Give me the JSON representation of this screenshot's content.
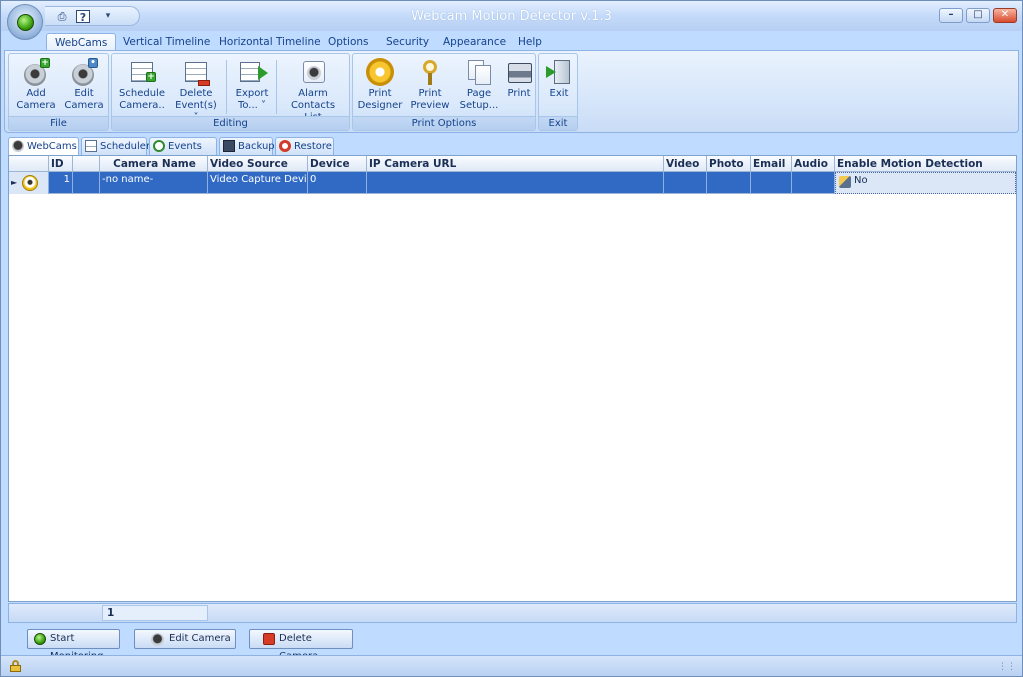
{
  "window": {
    "title": "Webcam Motion Detector v.1.3"
  },
  "qat": {
    "print_icon": "printer-icon",
    "help_icon": "help-icon",
    "menu_icon": "dropdown-icon"
  },
  "menu": {
    "tabs": [
      "WebCams",
      "Vertical Timeline",
      "Horizontal Timeline",
      "Options",
      "Security",
      "Appearance",
      "Help"
    ],
    "active": "WebCams"
  },
  "ribbon": {
    "groups": {
      "file": {
        "label": "File",
        "add_camera": [
          "Add",
          "Camera"
        ],
        "edit_camera": [
          "Edit",
          "Camera"
        ]
      },
      "editing": {
        "label": "Editing",
        "schedule_camera": [
          "Schedule",
          "Camera.."
        ],
        "delete_events": [
          "Delete",
          "Event(s) ˅"
        ],
        "export_to": [
          "Export",
          "To... ˅"
        ],
        "alarm_contacts": [
          "Alarm",
          "Contacts List"
        ]
      },
      "print_options": {
        "label": "Print Options",
        "print_designer": [
          "Print",
          "Designer"
        ],
        "print_preview": [
          "Print",
          "Preview"
        ],
        "page_setup": [
          "Page",
          "Setup..."
        ],
        "print": [
          "Print"
        ]
      },
      "exit": {
        "label": "Exit",
        "exit": [
          "Exit"
        ]
      }
    }
  },
  "subtabs": [
    "WebCams",
    "Scheduler",
    "Events List",
    "Backup",
    "Restore"
  ],
  "grid": {
    "columns": [
      "ID",
      "",
      "Camera Name",
      "Video Source",
      "Device",
      "IP Camera URL",
      "Video",
      "Photo",
      "Email",
      "Audio",
      "Enable Motion Detection"
    ],
    "rows": [
      {
        "id": "1",
        "camera_name": "-no name-",
        "video_source": "Video Capture Device",
        "device": "0",
        "ip_camera_url": "",
        "video": "",
        "photo": "",
        "email": "",
        "audio": "",
        "enable_motion_detection": "No"
      }
    ]
  },
  "footer": {
    "count": "1"
  },
  "buttons": {
    "start_monitoring": "Start Monitoring",
    "edit_camera": "Edit Camera",
    "delete_camera": "Delete Camera"
  },
  "status": {
    "lock_icon": "lock-icon"
  },
  "colors": {
    "selection": "#316ac5",
    "ribbon": "#bfdbff",
    "text": "#15428b"
  }
}
